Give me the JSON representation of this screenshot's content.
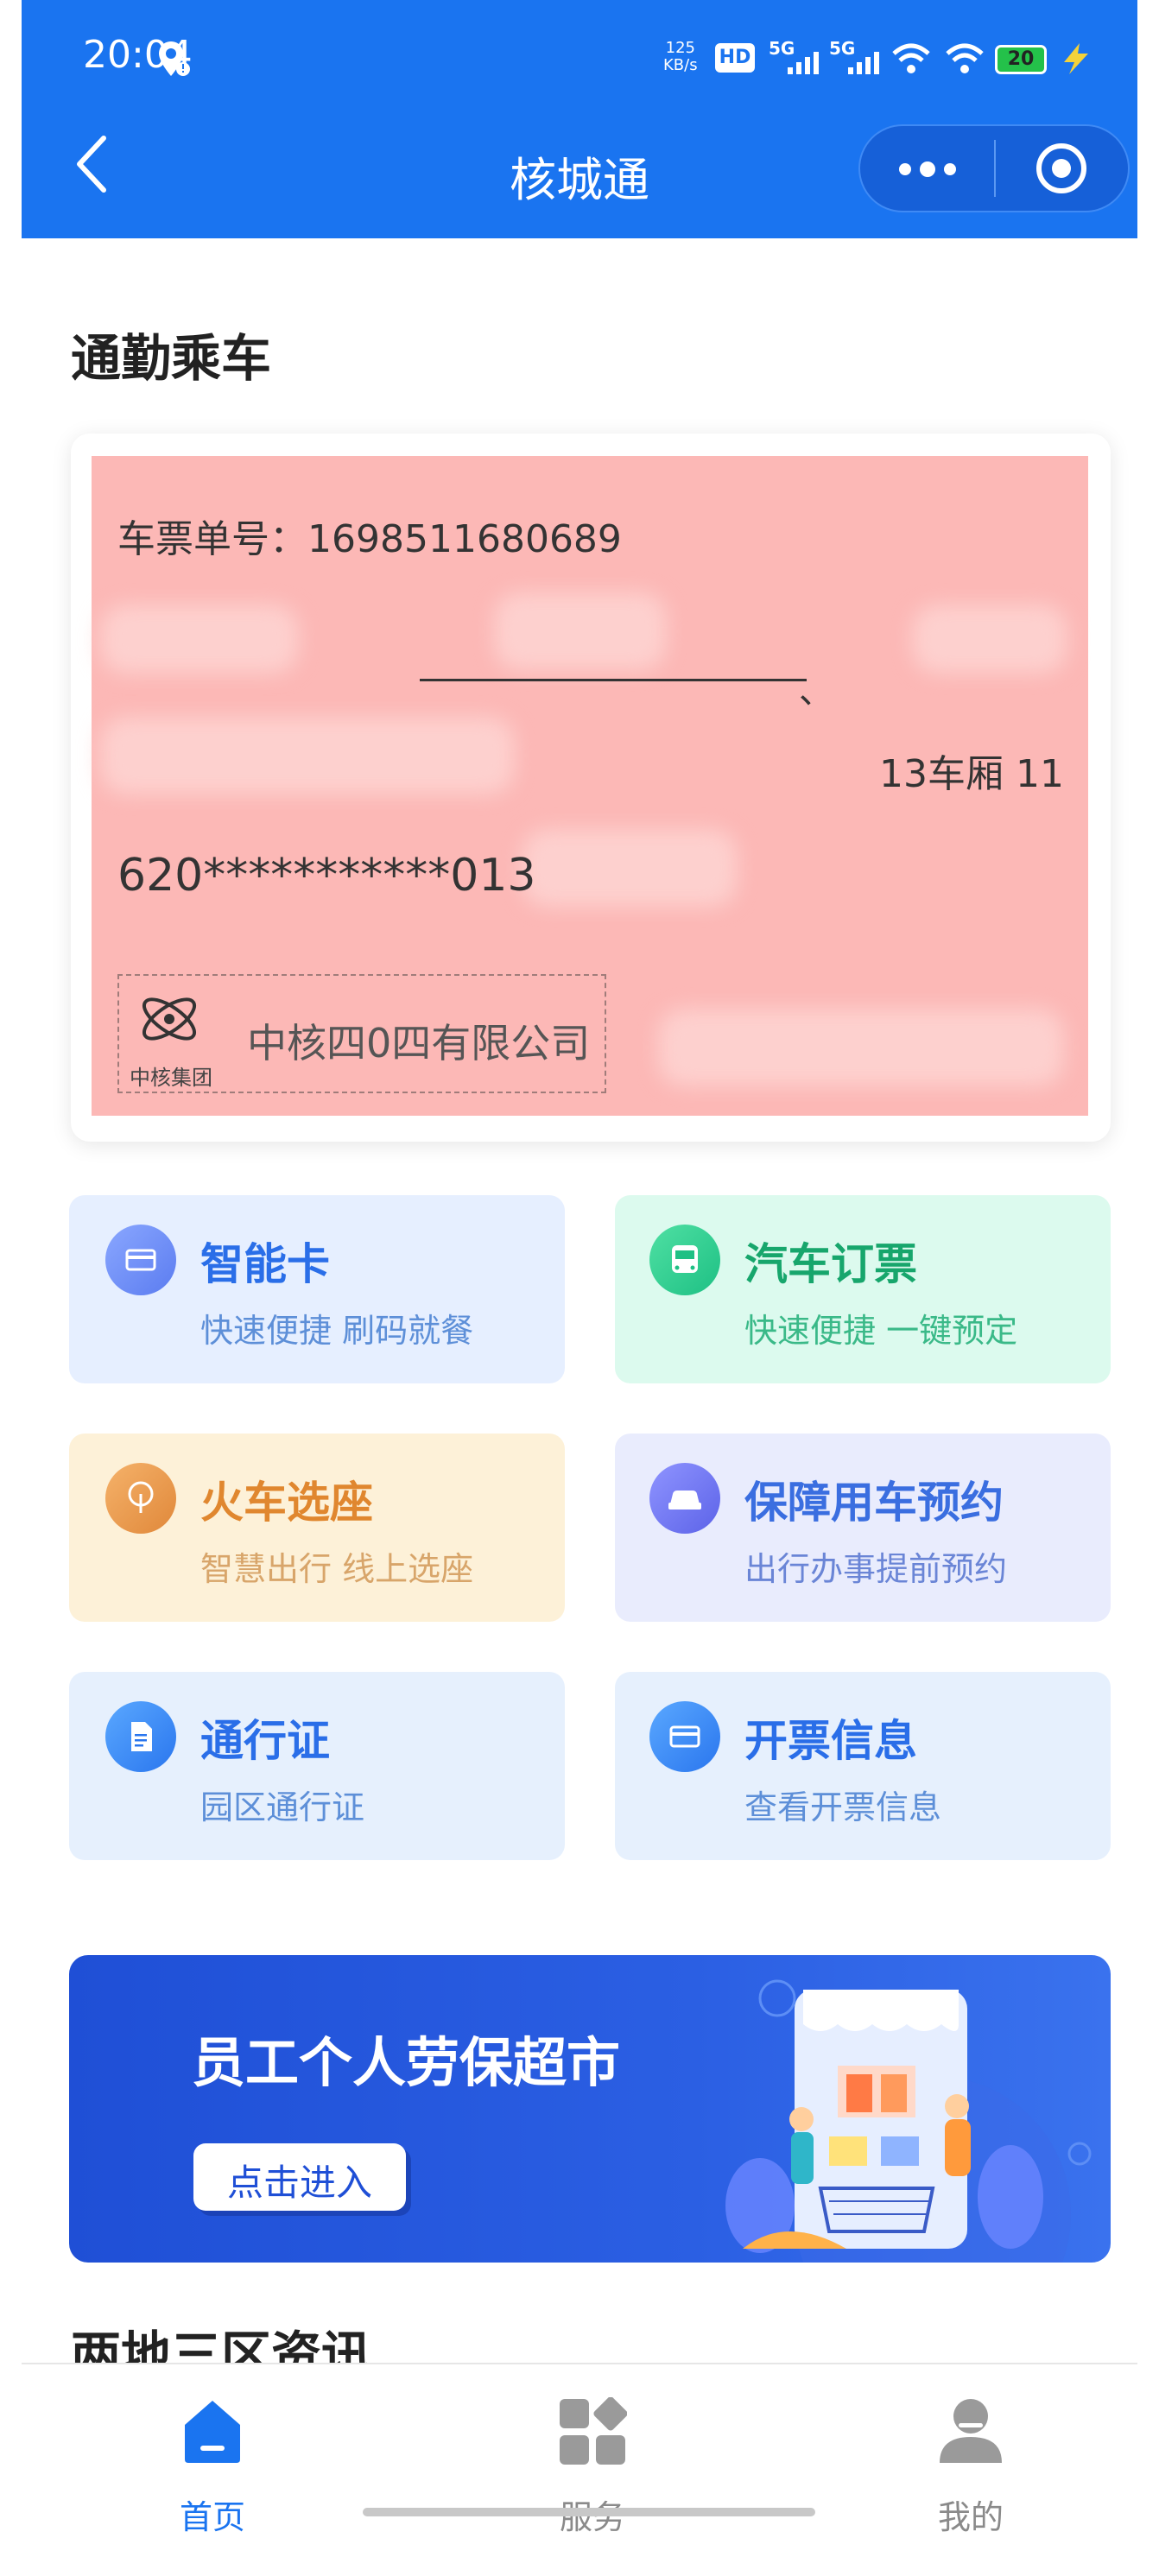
{
  "status_bar": {
    "time": "20:04",
    "speed": "125",
    "speed_unit": "KB/s",
    "hd": "HD",
    "network1": "5G",
    "network2": "5G",
    "battery": "20"
  },
  "nav": {
    "title": "核城通"
  },
  "section_commute": {
    "title": "通勤乘车"
  },
  "ticket": {
    "number_label": "车票单号：1698511680689",
    "tick_mark": "、",
    "seat": "13车厢 11",
    "id_masked": "620***********013",
    "logo_text": "中核集团",
    "company": "中核四0四有限公司"
  },
  "tiles": [
    {
      "title": "智能卡",
      "subtitle": "快速便捷 刷码就餐",
      "icon": "card-icon"
    },
    {
      "title": "汽车订票",
      "subtitle": "快速便捷 一键预定",
      "icon": "bus-icon"
    },
    {
      "title": "火车选座",
      "subtitle": "智慧出行 线上选座",
      "icon": "train-seat-icon"
    },
    {
      "title": "保障用车预约",
      "subtitle": "出行办事提前预约",
      "icon": "car-icon"
    },
    {
      "title": "通行证",
      "subtitle": "园区通行证",
      "icon": "document-icon"
    },
    {
      "title": "开票信息",
      "subtitle": "查看开票信息",
      "icon": "invoice-icon"
    }
  ],
  "banner": {
    "title": "员工个人劳保超市",
    "button": "点击进入"
  },
  "section_news": {
    "title": "两地三区资讯"
  },
  "tabbar": {
    "items": [
      {
        "label": "首页",
        "icon": "home-icon",
        "active": true
      },
      {
        "label": "服务",
        "icon": "services-icon",
        "active": false
      },
      {
        "label": "我的",
        "icon": "profile-icon",
        "active": false
      }
    ]
  },
  "colors": {
    "primary": "#1a74f0",
    "ticket_bg": "#fcb8b6"
  }
}
